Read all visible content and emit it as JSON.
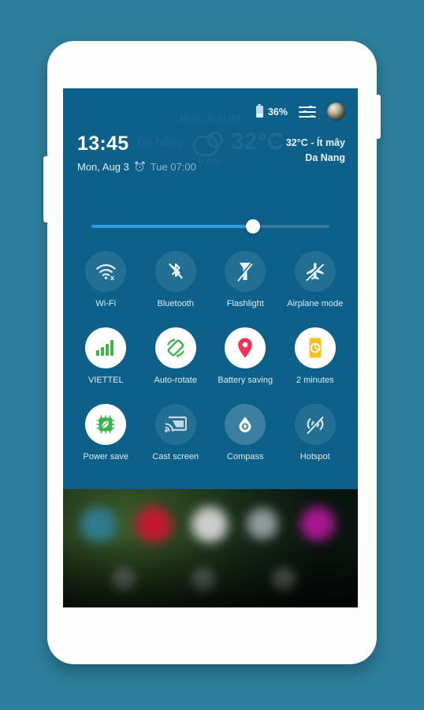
{
  "device": {
    "frame_color": "#fdfdfd",
    "background_color": "#2d7f9d",
    "screen_bg": "#0c6089",
    "accent_color": "#2f9be0"
  },
  "statusbar": {
    "battery_icon": "battery-icon",
    "battery_percent": "36%",
    "settings_icon": "settings-sliders-icon",
    "avatar_icon": "user-avatar"
  },
  "clock": {
    "time": "13:45",
    "date": "Mon, Aug 3",
    "alarm_icon": "alarm-clock-icon",
    "alarm_time": "Tue 07:00"
  },
  "weather": {
    "temperature": "32°C - Ít mây",
    "city": "Da Nang",
    "ghost_date": "Mon, Aug 03",
    "ghost_city": "Da Nẵng",
    "ghost_temp": "32°C",
    "ghost_sub": "Ít mây"
  },
  "brightness": {
    "label": "brightness-slider",
    "value_percent": 68
  },
  "tiles": [
    [
      {
        "label": "Wi-Fi",
        "icon": "wifi-off-icon",
        "state": "off"
      },
      {
        "label": "Bluetooth",
        "icon": "bluetooth-off-icon",
        "state": "off"
      },
      {
        "label": "Flashlight",
        "icon": "flashlight-off-icon",
        "state": "off"
      },
      {
        "label": "Airplane mode",
        "icon": "airplane-off-icon",
        "state": "off"
      }
    ],
    [
      {
        "label": "VIETTEL",
        "icon": "signal-bars-icon",
        "state": "on"
      },
      {
        "label": "Auto-rotate",
        "icon": "auto-rotate-icon",
        "state": "on"
      },
      {
        "label": "Battery saving",
        "icon": "location-pin-icon",
        "state": "on"
      },
      {
        "label": "2 minutes",
        "icon": "screen-timeout-icon",
        "state": "on"
      }
    ],
    [
      {
        "label": "Power save",
        "icon": "power-save-leaf-icon",
        "state": "on"
      },
      {
        "label": "Cast screen",
        "icon": "cast-screen-icon",
        "state": "off"
      },
      {
        "label": "Compass",
        "icon": "compass-icon",
        "state": "semi"
      },
      {
        "label": "Hotspot",
        "icon": "hotspot-off-icon",
        "state": "off"
      }
    ]
  ]
}
